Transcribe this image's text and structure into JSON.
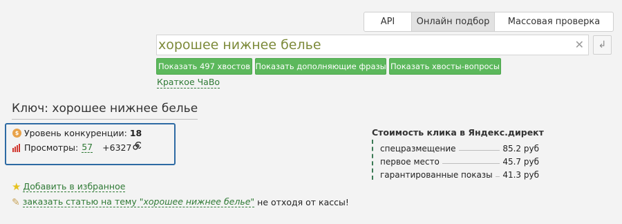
{
  "tabs": {
    "api": "API",
    "online": "Онлайн подбор",
    "mass": "Массовая проверка"
  },
  "search": {
    "value": "хорошее нижнее белье",
    "clear_icon": "close-icon",
    "enter_icon": "enter-arrow-icon"
  },
  "actions": {
    "show_tails": "Показать 497 хвостов",
    "show_additional": "Показать дополняющие фразы",
    "show_questions": "Показать хвосты-вопросы"
  },
  "faq_link": "Краткое ЧаВо",
  "key": {
    "title": "Ключ: хорошее нижнее белье"
  },
  "stats": {
    "competition_label": "Уровень конкуренции:",
    "competition_value": "18",
    "views_label": "Просмотры:",
    "views_value": "57",
    "views_growth": "+6327",
    "icons": [
      "coins-icon",
      "bar-chart-icon",
      "spiral-icon"
    ]
  },
  "cost": {
    "title": "Стоимость клика в Яндекс.директ",
    "rows": [
      {
        "label": "спецразмещение",
        "value": "85.2 руб"
      },
      {
        "label": "первое место",
        "value": "45.7 руб"
      },
      {
        "label": "гарантированные показы",
        "value": "41.3 руб"
      }
    ]
  },
  "footer": {
    "favorite_link": "Добавить в избранное",
    "order_prefix": "заказать статью на тему \"",
    "order_topic": "хорошее нижнее белье",
    "order_close": "\"",
    "order_suffix": "не отходя от кассы!",
    "icons": [
      "star-icon",
      "pencil-icon"
    ]
  },
  "colors": {
    "accent_green": "#5cb85c",
    "link_green": "#2f7a35",
    "panel_border": "#2d6aa3",
    "search_text": "#7d8a3a"
  }
}
